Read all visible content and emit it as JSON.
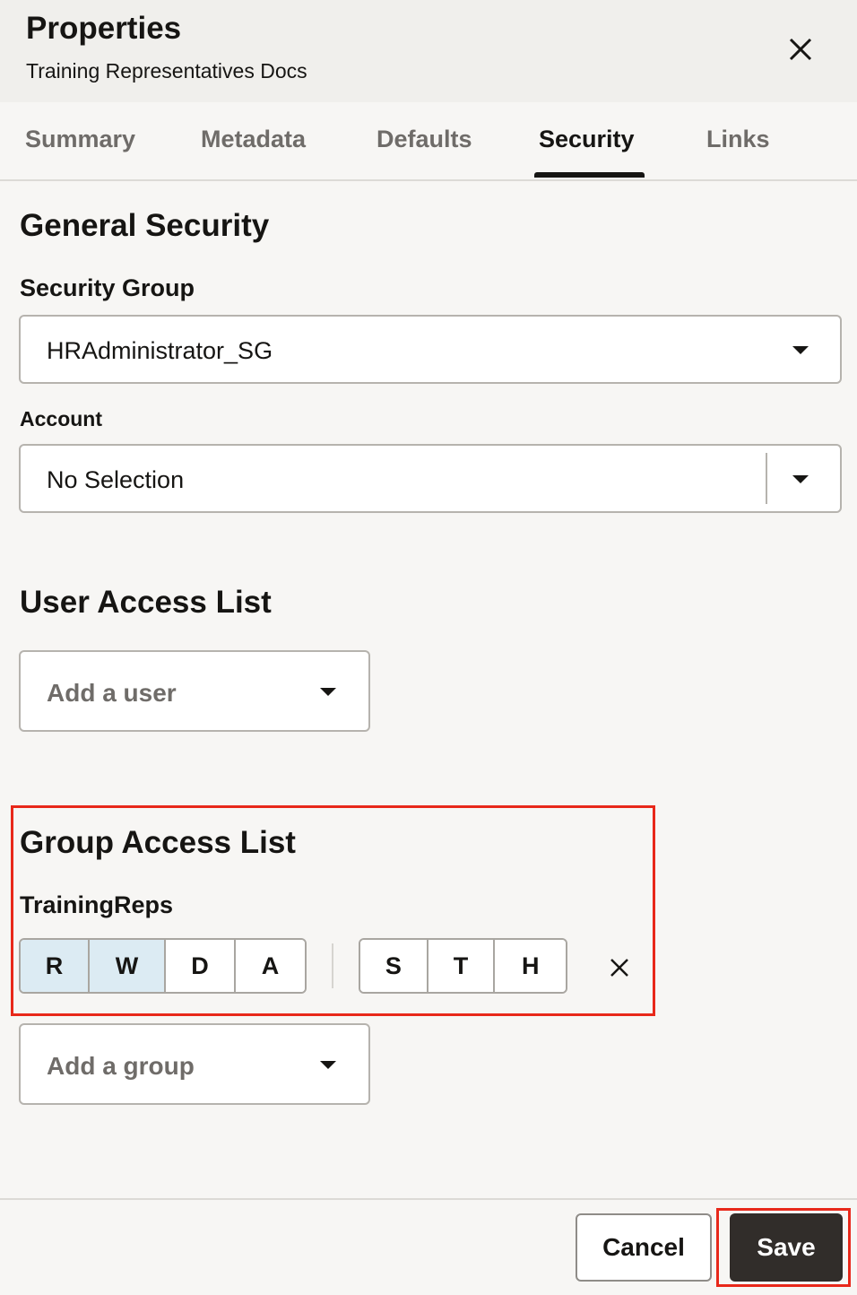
{
  "header": {
    "title": "Properties",
    "subtitle": "Training Representatives Docs",
    "close_icon": "close-icon"
  },
  "tabs": [
    {
      "label": "Summary",
      "active": false
    },
    {
      "label": "Metadata",
      "active": false
    },
    {
      "label": "Defaults",
      "active": false
    },
    {
      "label": "Security",
      "active": true
    },
    {
      "label": "Links",
      "active": false
    }
  ],
  "general_security": {
    "title": "General Security",
    "security_group_label": "Security Group",
    "security_group_value": "HRAdministrator_SG",
    "account_label": "Account",
    "account_value": "No Selection"
  },
  "user_access": {
    "title": "User Access List",
    "add_user_placeholder": "Add a user"
  },
  "group_access": {
    "title": "Group Access List",
    "group_name": "TrainingReps",
    "permissions": [
      {
        "label": "R",
        "selected": true
      },
      {
        "label": "W",
        "selected": true
      },
      {
        "label": "D",
        "selected": false
      },
      {
        "label": "A",
        "selected": false
      }
    ],
    "extra_permissions": [
      {
        "label": "S",
        "selected": false
      },
      {
        "label": "T",
        "selected": false
      },
      {
        "label": "H",
        "selected": false
      }
    ],
    "remove_icon": "close-icon",
    "add_group_placeholder": "Add a group"
  },
  "footer": {
    "cancel_label": "Cancel",
    "save_label": "Save"
  },
  "colors": {
    "highlight": "#e8281a",
    "selected_permission": "#dcebf3",
    "primary_button": "#312d2a"
  }
}
